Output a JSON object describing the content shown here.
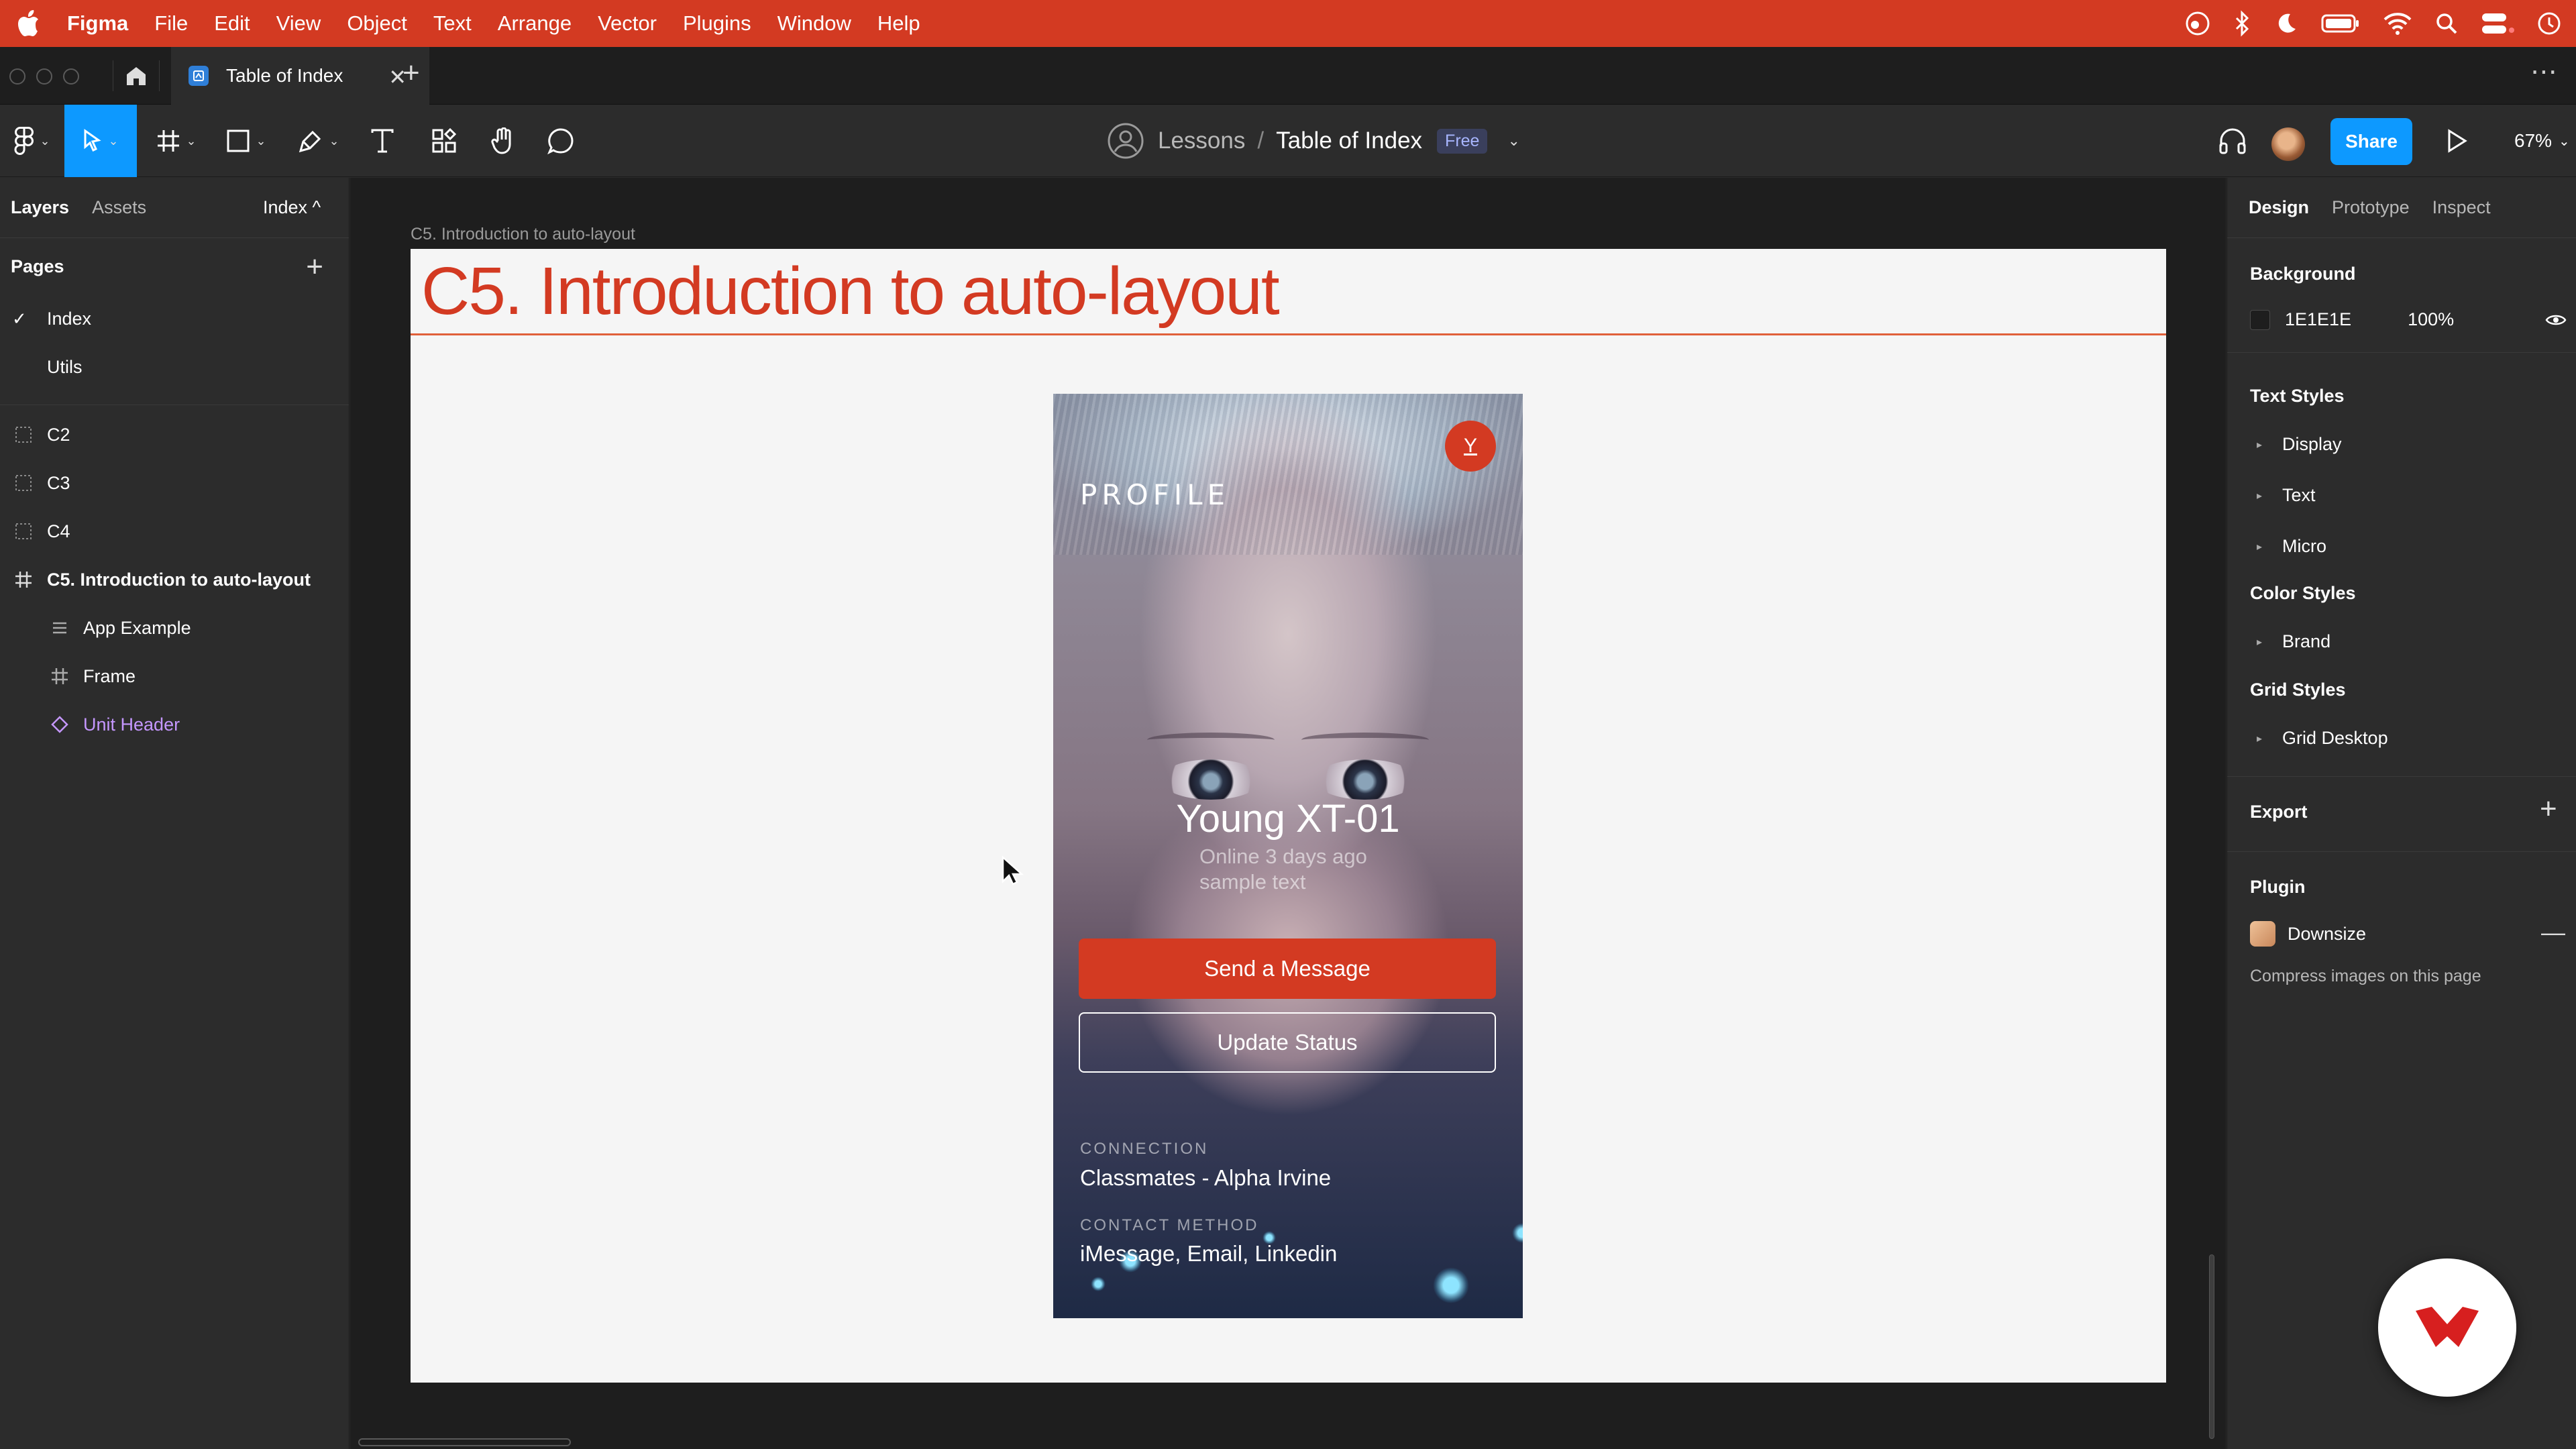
{
  "menubar": {
    "app_name": "Figma",
    "items": [
      "File",
      "Edit",
      "View",
      "Object",
      "Text",
      "Arrange",
      "Vector",
      "Plugins",
      "Window",
      "Help"
    ],
    "status_icons": [
      "creative-cloud-icon",
      "bluetooth-icon",
      "moon-icon",
      "battery-icon",
      "wifi-icon",
      "search-icon",
      "control-center-icon",
      "clock-icon"
    ]
  },
  "tabs": {
    "file_tab_title": "Table of Index",
    "new_tab": "+",
    "more": "⋯"
  },
  "toolbar": {
    "team": "Lessons",
    "separator": "/",
    "file_name": "Table of Index",
    "plan_badge": "Free",
    "share_label": "Share",
    "zoom": "67%"
  },
  "left_panel": {
    "tabs": [
      "Layers",
      "Assets"
    ],
    "page_selector": "Index ^",
    "pages_title": "Pages",
    "add_page": "+",
    "pages": [
      {
        "label": "Index",
        "current": true
      },
      {
        "label": "Utils",
        "current": false
      }
    ],
    "layers": [
      {
        "label": "C2",
        "type": "section"
      },
      {
        "label": "C3",
        "type": "section"
      },
      {
        "label": "C4",
        "type": "section"
      },
      {
        "label": "C5. Introduction to auto-layout",
        "type": "frame"
      },
      {
        "label": "App Example",
        "type": "autolayout"
      },
      {
        "label": "Frame",
        "type": "frame"
      },
      {
        "label": "Unit Header",
        "type": "component"
      }
    ]
  },
  "canvas": {
    "frame_label": "C5. Introduction to auto-layout",
    "frame_title": "C5.  Introduction to auto-layout",
    "profile_card": {
      "badge_letter": "Y",
      "heading": "PROFILE",
      "name": "Young XT-01",
      "online": "Online 3 days ago",
      "sample": "sample text",
      "primary_button": "Send a Message",
      "secondary_button": "Update Status",
      "connection_label": "CONNECTION",
      "connection_value": "Classmates - Alpha Irvine",
      "contact_label": "CONTACT METHOD",
      "contact_value": "iMessage, Email, Linkedin"
    }
  },
  "right_panel": {
    "tabs": [
      "Design",
      "Prototype",
      "Inspect"
    ],
    "background_title": "Background",
    "background_hex": "1E1E1E",
    "background_opacity": "100%",
    "text_styles_title": "Text Styles",
    "text_styles": [
      "Display",
      "Text",
      "Micro"
    ],
    "color_styles_title": "Color Styles",
    "color_styles": [
      "Brand"
    ],
    "grid_styles_title": "Grid Styles",
    "grid_styles": [
      "Grid Desktop"
    ],
    "export_title": "Export",
    "export_add": "+",
    "plugin_title": "Plugin",
    "plugin_name": "Downsize",
    "plugin_description": "Compress images on this page"
  },
  "colors": {
    "accent_red": "#d33a22",
    "figma_blue": "#0d99ff",
    "canvas_bg": "#1e1e1e",
    "panel_bg": "#2c2c2c",
    "component_purple": "#c597ff"
  }
}
